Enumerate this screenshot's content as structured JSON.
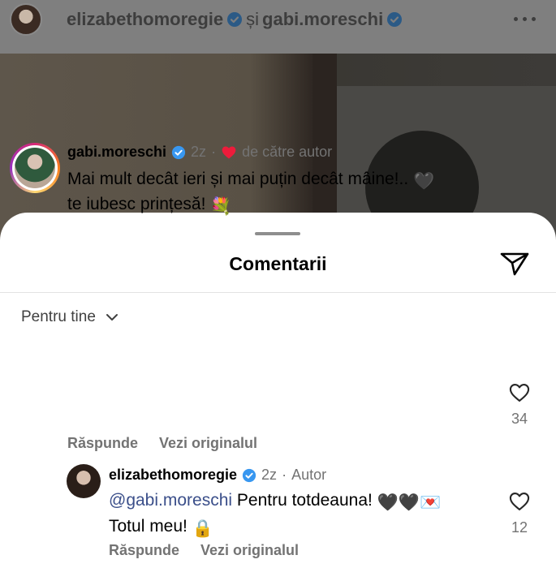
{
  "post": {
    "author": "elizabethomoregie",
    "join_word": "și",
    "collaborator": "gabi.moreschi"
  },
  "sheet": {
    "title": "Comentarii",
    "sort_label": "Pentru tine"
  },
  "comments": [
    {
      "username": "gabi.moreschi",
      "time": "2z",
      "liked_by_author": "de către autor",
      "text_line1": "Mai mult decât ieri și mai puțin decât mâine!..",
      "text_line2": "te iubesc prințesă!",
      "like_count": "34",
      "reply_label": "Răspunde",
      "translate_label": "Vezi originalul"
    }
  ],
  "reply": {
    "username": "elizabethomoregie",
    "time": "2z",
    "separator": "·",
    "badge": "Autor",
    "mention": "@gabi.moreschi",
    "text_line1": "Pentru totdeauna!",
    "text_line2": "Totul meu!",
    "like_count": "12",
    "reply_label": "Răspunde",
    "translate_label": "Vezi originalul"
  },
  "icons": {
    "verified": "verified-badge-icon",
    "heart_filled": "heart-filled-icon",
    "heart_outline": "heart-outline-icon",
    "share": "share-send-icon",
    "more": "more-options-icon",
    "chevron": "chevron-down-icon"
  },
  "colors": {
    "verified_blue": "#3897f0",
    "heart_red": "#ed1c3b",
    "mention_blue": "#3b4f8a",
    "muted_text": "#737373"
  }
}
